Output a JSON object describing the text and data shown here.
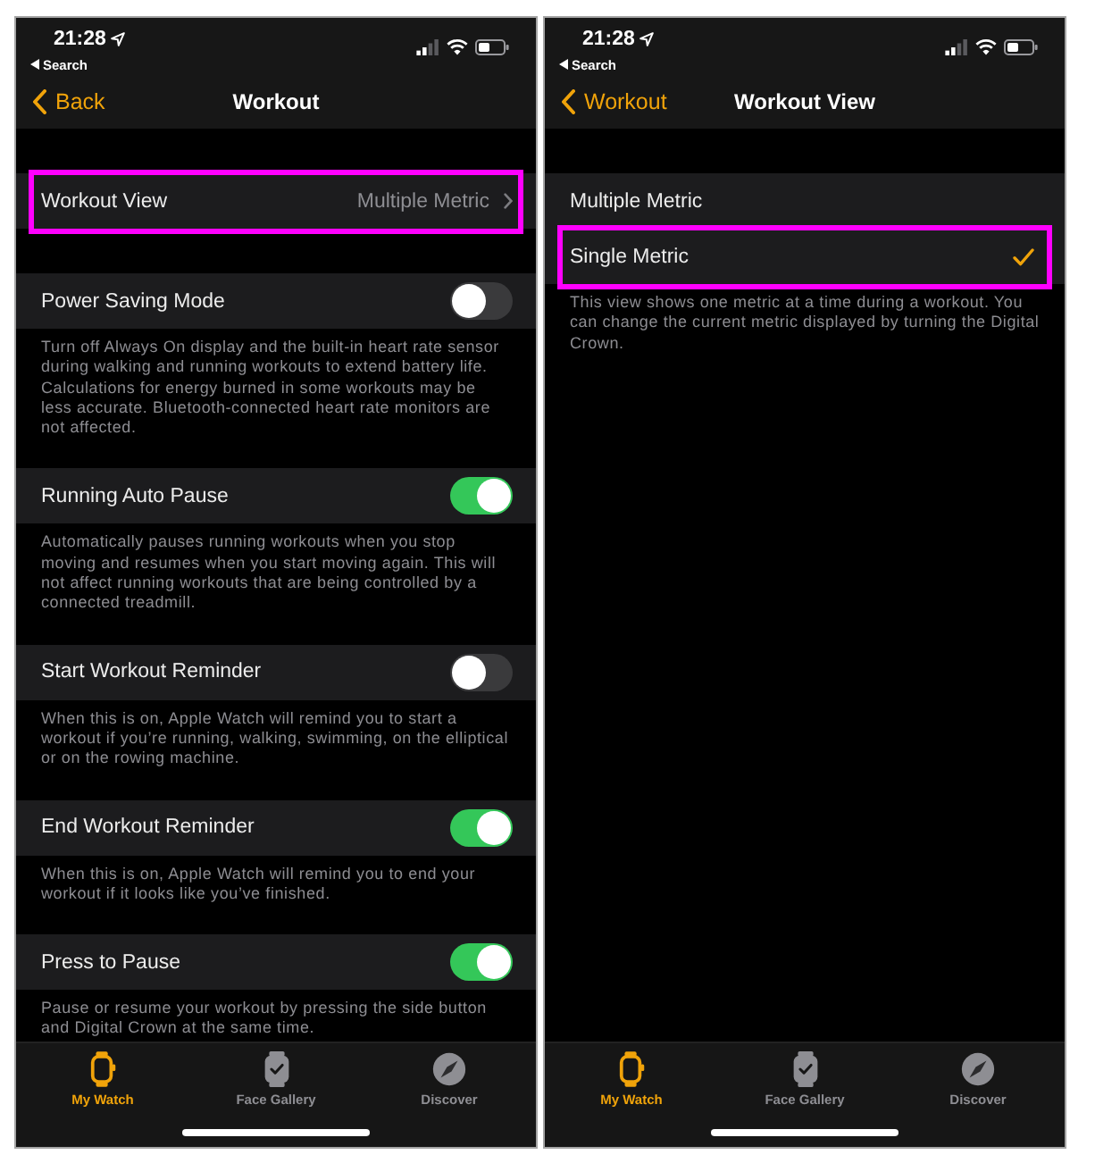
{
  "screens": [
    {
      "status_bar": {
        "time": "21:28",
        "back_app": "Search"
      },
      "nav_bar": {
        "back": "Back",
        "title": "Workout"
      },
      "groups": [
        {
          "rows": [
            {
              "kind": "disclosure",
              "label": "Workout View",
              "value": "Multiple Metric",
              "highlighted": true
            }
          ]
        },
        {
          "rows": [
            {
              "kind": "toggle",
              "label": "Power Saving Mode",
              "on": false,
              "highlighted": false
            }
          ],
          "footer": "Turn off Always On display and the built-in heart rate sensor during walking and running workouts to extend battery life. Calculations for energy burned in some workouts may be less accurate. Bluetooth-connected heart rate monitors are not affected."
        },
        {
          "rows": [
            {
              "kind": "toggle",
              "label": "Running Auto Pause",
              "on": true,
              "highlighted": false
            }
          ],
          "footer": "Automatically pauses running workouts when you stop moving and resumes when you start moving again. This will not affect running workouts that are being controlled by a connected treadmill."
        },
        {
          "rows": [
            {
              "kind": "toggle",
              "label": "Start Workout Reminder",
              "on": false,
              "highlighted": false
            }
          ],
          "footer": "When this is on, Apple Watch will remind you to start a workout if you’re running, walking, swimming, on the elliptical or on the rowing machine."
        },
        {
          "rows": [
            {
              "kind": "toggle",
              "label": "End Workout Reminder",
              "on": true,
              "highlighted": false
            }
          ],
          "footer": "When this is on, Apple Watch will remind you to end your workout if it looks like you’ve finished."
        },
        {
          "rows": [
            {
              "kind": "toggle",
              "label": "Press to Pause",
              "on": true,
              "highlighted": false
            }
          ],
          "footer": "Pause or resume your workout by pressing the side button and Digital Crown at the same time."
        }
      ],
      "tab_bar": [
        {
          "label": "My Watch",
          "selected": true
        },
        {
          "label": "Face Gallery",
          "selected": false
        },
        {
          "label": "Discover",
          "selected": false
        }
      ]
    },
    {
      "status_bar": {
        "time": "21:28",
        "back_app": "Search"
      },
      "nav_bar": {
        "back": "Workout",
        "title": "Workout View"
      },
      "groups": [
        {
          "rows": [
            {
              "kind": "option",
              "label": "Multiple Metric",
              "selected": false,
              "highlighted": false
            },
            {
              "kind": "option",
              "label": "Single Metric",
              "selected": true,
              "highlighted": true
            }
          ],
          "footer": "This view shows one metric at a time during a workout. You can change the current metric displayed by turning the Digital Crown."
        }
      ],
      "tab_bar": [
        {
          "label": "My Watch",
          "selected": true
        },
        {
          "label": "Face Gallery",
          "selected": false
        },
        {
          "label": "Discover",
          "selected": false
        }
      ]
    }
  ]
}
